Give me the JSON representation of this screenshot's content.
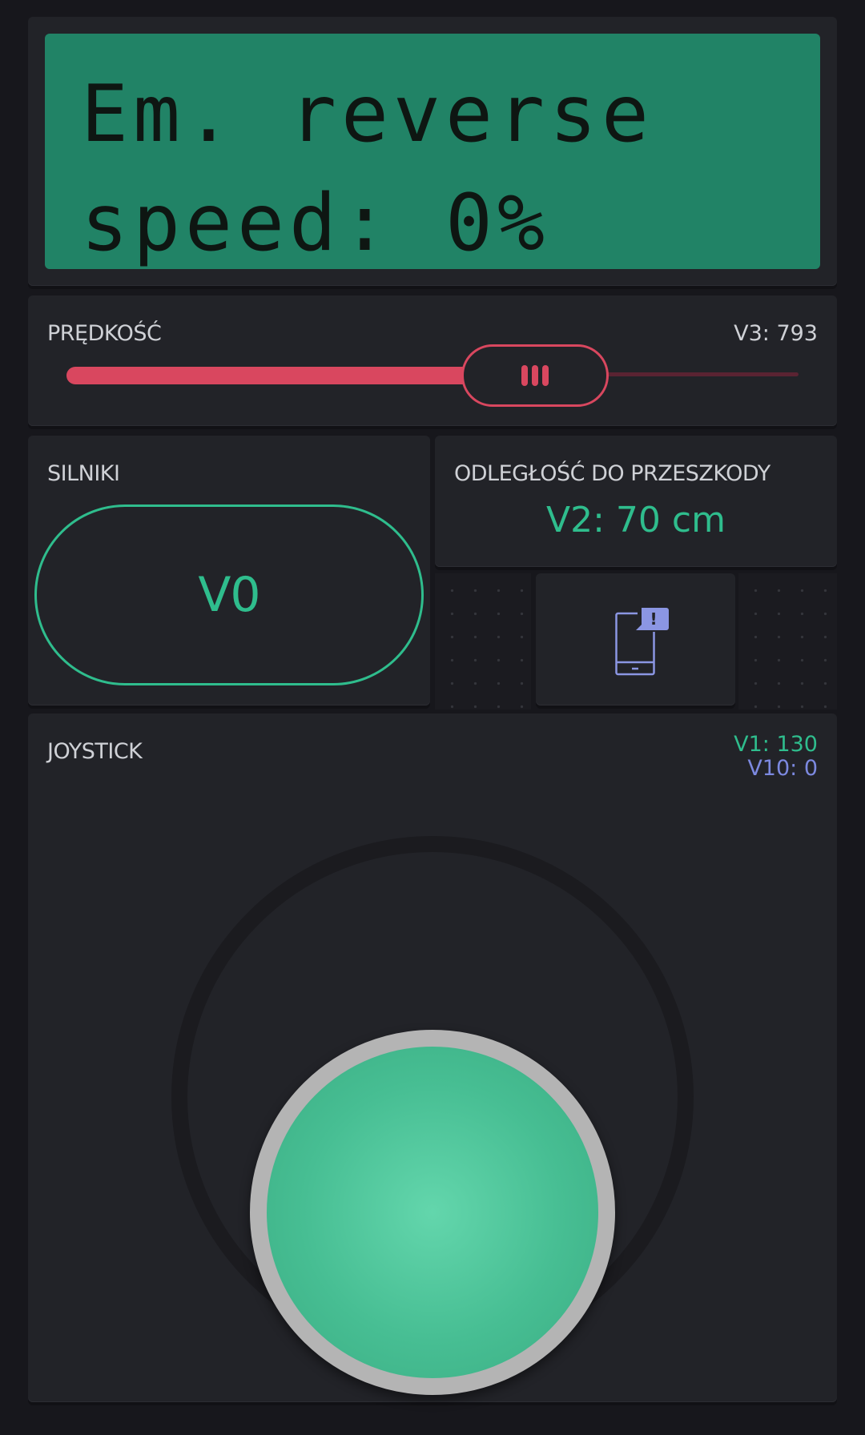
{
  "lcd": {
    "line1": "Em. reverse",
    "line2": "speed: 0%"
  },
  "slider": {
    "label": "PRĘDKOŚĆ",
    "value_text": "V3: 793",
    "level_fraction": 0.64,
    "color": "#d9475f"
  },
  "motors_button": {
    "label": "SILNIKI",
    "button_text": "V0",
    "color": "#2fbd8d"
  },
  "distance": {
    "label": "ODLEGŁOŚĆ DO PRZESZKODY",
    "value": "V2: 70 cm"
  },
  "notification": {
    "icon": "phone-notification-icon",
    "badge": "!"
  },
  "joystick": {
    "label": "JOYSTICK",
    "v1": "V1: 130",
    "v10": "V10: 0",
    "knob_offset": {
      "x": 0.0,
      "y": 0.47
    }
  },
  "colors": {
    "accent_green": "#2fbd8d",
    "accent_red": "#d9475f",
    "accent_blue": "#7c89e0",
    "lcd_green": "#218366"
  }
}
